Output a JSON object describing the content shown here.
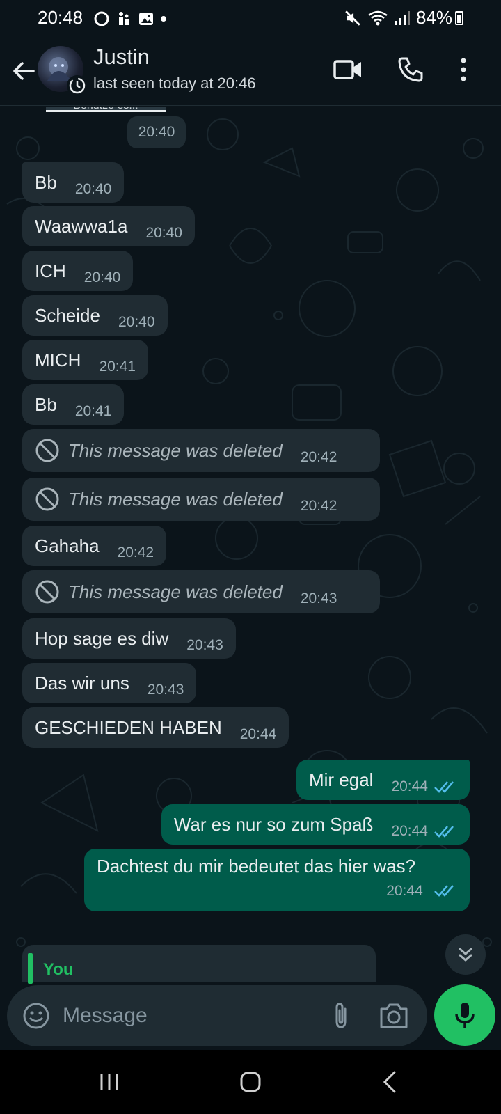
{
  "status_bar": {
    "time": "20:48",
    "battery": "84%"
  },
  "header": {
    "contact_name": "Justin",
    "last_seen": "last seen today at 20:46"
  },
  "chat": {
    "clipped_image_caption": "Benutze es..!",
    "clipped_image_time": "20:40",
    "messages": [
      {
        "dir": "in",
        "text": "Bb",
        "time": "20:40"
      },
      {
        "dir": "in",
        "text": "Waawwa1a",
        "time": "20:40"
      },
      {
        "dir": "in",
        "text": "ICH",
        "time": "20:40"
      },
      {
        "dir": "in",
        "text": "Scheide",
        "time": "20:40"
      },
      {
        "dir": "in",
        "text": "MICH",
        "time": "20:41"
      },
      {
        "dir": "in",
        "text": "Bb",
        "time": "20:41"
      },
      {
        "dir": "in",
        "deleted": true,
        "text": "This message was deleted",
        "time": "20:42"
      },
      {
        "dir": "in",
        "deleted": true,
        "text": "This message was deleted",
        "time": "20:42"
      },
      {
        "dir": "in",
        "text": "Gahaha",
        "time": "20:42"
      },
      {
        "dir": "in",
        "deleted": true,
        "text": "This message was deleted",
        "time": "20:43"
      },
      {
        "dir": "in",
        "text": "Hop sage es diw",
        "time": "20:43"
      },
      {
        "dir": "in",
        "text": "Das wir uns",
        "time": "20:43"
      },
      {
        "dir": "in",
        "text": "GESCHIEDEN HABEN",
        "time": "20:44"
      },
      {
        "dir": "out",
        "text": "Mir egal",
        "time": "20:44",
        "status": "read"
      },
      {
        "dir": "out",
        "text": "War es nur so zum Spaß",
        "time": "20:44",
        "status": "read"
      },
      {
        "dir": "out",
        "text": "Dachtest du mir bedeutet das hier was?",
        "time": "20:44",
        "status": "read"
      }
    ]
  },
  "reply_preview": {
    "label": "You"
  },
  "composer": {
    "placeholder": "Message"
  },
  "icons": {
    "back": "arrow-left-icon",
    "video": "video-call-icon",
    "call": "phone-icon",
    "menu": "more-vert-icon",
    "emoji": "emoji-icon",
    "attach": "paperclip-icon",
    "camera": "camera-icon",
    "mic": "microphone-icon",
    "scroll": "chevrons-down-icon"
  },
  "colors": {
    "background": "#0b141a",
    "incoming_bubble": "#202c33",
    "outgoing_bubble": "#005c4b",
    "accent_green": "#21c063",
    "read_tick": "#53bdeb"
  }
}
